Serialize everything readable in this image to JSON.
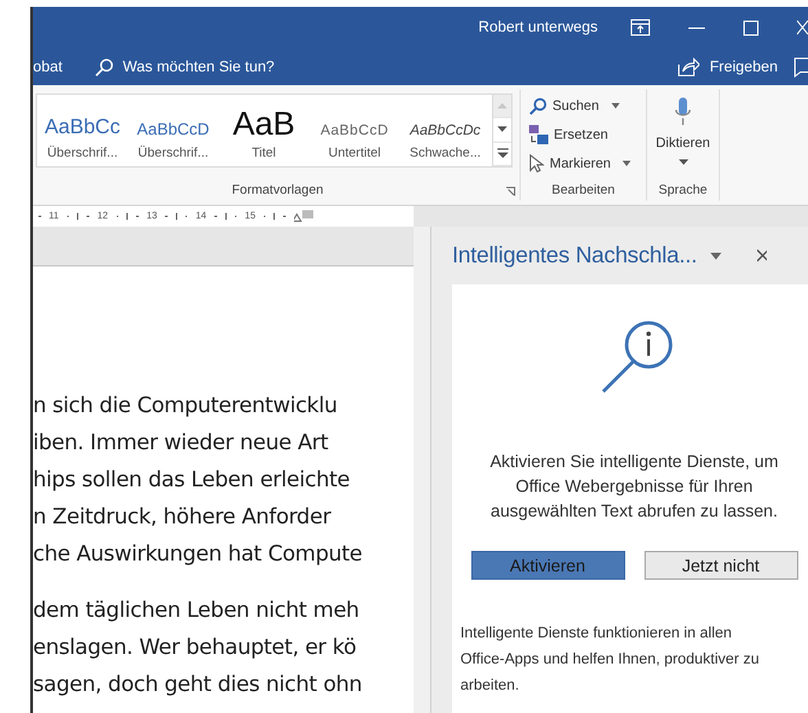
{
  "title_bar": {
    "user": "Robert unterwegs"
  },
  "tell_me": {
    "tab_fragment": "obat",
    "placeholder": "Was möchten Sie tun?",
    "share": "Freigeben"
  },
  "styles_group": {
    "label": "Formatvorlagen",
    "styles": [
      {
        "kind": "heading1",
        "preview": "AaBbCc",
        "label": "Überschrif..."
      },
      {
        "kind": "heading2",
        "preview": "AaBbCcD",
        "label": "Überschrif..."
      },
      {
        "kind": "title",
        "preview": "AaB",
        "label": "Titel"
      },
      {
        "kind": "subtitle",
        "preview": "AaBbCcD",
        "label": "Untertitel"
      },
      {
        "kind": "subtle",
        "preview": "AaBbCcDc",
        "label": "Schwache..."
      }
    ]
  },
  "editing_group": {
    "label": "Bearbeiten",
    "items": [
      {
        "kind": "search",
        "label": "Suchen",
        "dropdown": true
      },
      {
        "kind": "replace",
        "label": "Ersetzen",
        "dropdown": false
      },
      {
        "kind": "select",
        "label": "Markieren",
        "dropdown": true
      }
    ]
  },
  "speech_group": {
    "label": "Sprache",
    "button": "Diktieren"
  },
  "ruler": {
    "ticks": [
      "11",
      "12",
      "13",
      "14",
      "15"
    ]
  },
  "document": {
    "paragraphs": [
      [
        "n sich die Computerentwicklu",
        "iben. Immer wieder neue Art",
        "hips sollen das Leben erleichte",
        "n Zeitdruck, höhere Anforder",
        "che Auswirkungen hat Compute"
      ],
      [
        "dem täglichen Leben nicht meh",
        "enslagen. Wer behauptet, er kö",
        "sagen, doch geht dies nicht ohn"
      ]
    ]
  },
  "pane": {
    "title": "Intelligentes Nachschla...",
    "message": "Aktivieren Sie intelligente Dienste, um Office Webergebnisse für Ihren ausgewählten Text abrufen zu lassen.",
    "buttons": [
      {
        "label": "Aktivieren",
        "primary": true
      },
      {
        "label": "Jetzt nicht",
        "primary": false
      }
    ],
    "note": "Intelligente Dienste funktionieren in allen Office-Apps und helfen Ihnen, produktiver zu arbeiten."
  }
}
